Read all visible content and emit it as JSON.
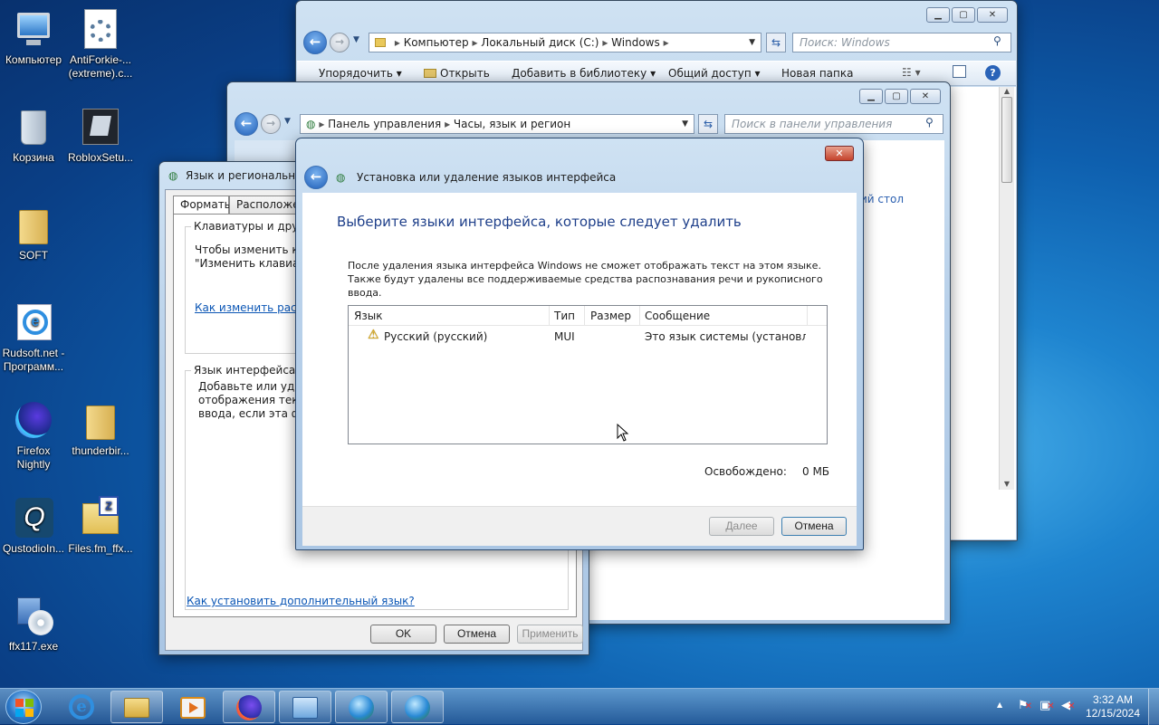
{
  "desktop": {
    "icons": [
      {
        "label": "Компьютер",
        "icon": "computer-icon"
      },
      {
        "label": "AntiForkie-...\n(extreme).c...",
        "icon": "settings-file-icon"
      },
      {
        "label": "Корзина",
        "icon": "recycle-bin-icon"
      },
      {
        "label": "RobloxSetu...",
        "icon": "roblox-setup-icon"
      },
      {
        "label": "SOFT",
        "icon": "folder-icon"
      },
      {
        "label": "Rudsoft.net -\nПрограмм...",
        "icon": "ie-shortcut-icon"
      },
      {
        "label": "Firefox\nNightly",
        "icon": "firefox-nightly-icon"
      },
      {
        "label": "thunderbir...",
        "icon": "folder-icon"
      },
      {
        "label": "QustodioIn...",
        "icon": "qustodio-icon"
      },
      {
        "label": "Files.fm_ffx...",
        "icon": "zip-folder-icon"
      },
      {
        "label": "ffx117.exe",
        "icon": "installer-icon"
      }
    ]
  },
  "explorer": {
    "breadcrumb": [
      "Компьютер",
      "Локальный диск (C:)",
      "Windows"
    ],
    "search_placeholder": "Поиск: Windows",
    "toolbar": [
      "Упорядочить",
      "Открыть",
      "Добавить в библиотеку",
      "Общий доступ",
      "Новая папка"
    ]
  },
  "control_panel": {
    "breadcrumb": [
      "Панель управления",
      "Часы, язык и регион"
    ],
    "search_placeholder": "Поиск в панели управления",
    "partial_text": "ий стол"
  },
  "region_dialog": {
    "title": "Язык и региональные",
    "tabs": [
      "Форматы",
      "Расположен"
    ],
    "keyboards_group": "Клавиатуры и другие",
    "keyboards_text": "Чтобы изменить кла\n\"Изменить клавиату",
    "keyboards_link": "Как изменить раскла",
    "lang_group": "Язык интерфейса",
    "lang_text": "Добавьте или удали\nотображения текста\nввода, если эта фун",
    "install_link": "Как установить дополнительный язык?",
    "buttons": {
      "ok": "OK",
      "cancel": "Отмена",
      "apply": "Применить"
    }
  },
  "wizard": {
    "title": "Установка или удаление языков интерфейса",
    "heading": "Выберите языки интерфейса, которые следует удалить",
    "description": "После удаления языка интерфейса Windows не сможет отображать текст на этом языке. Также будут удалены все поддерживаемые средства распознавания речи и рукописного ввода.",
    "columns": [
      "Язык",
      "Тип",
      "Размер",
      "Сообщение"
    ],
    "rows": [
      {
        "language": "Русский (русский)",
        "type": "MUI",
        "size": "",
        "message": "Это язык системы (установле..."
      }
    ],
    "freed_label": "Освобождено:",
    "freed_value": "0 МБ",
    "buttons": {
      "next": "Далее",
      "cancel": "Отмена"
    }
  },
  "taskbar": {
    "clock_time": "3:32 AM",
    "clock_date": "12/15/2024",
    "tray_arrow": "▲"
  },
  "colors": {
    "accent": "#1e5aa8",
    "heading": "#1e3f8a",
    "link": "#0b56b5"
  }
}
